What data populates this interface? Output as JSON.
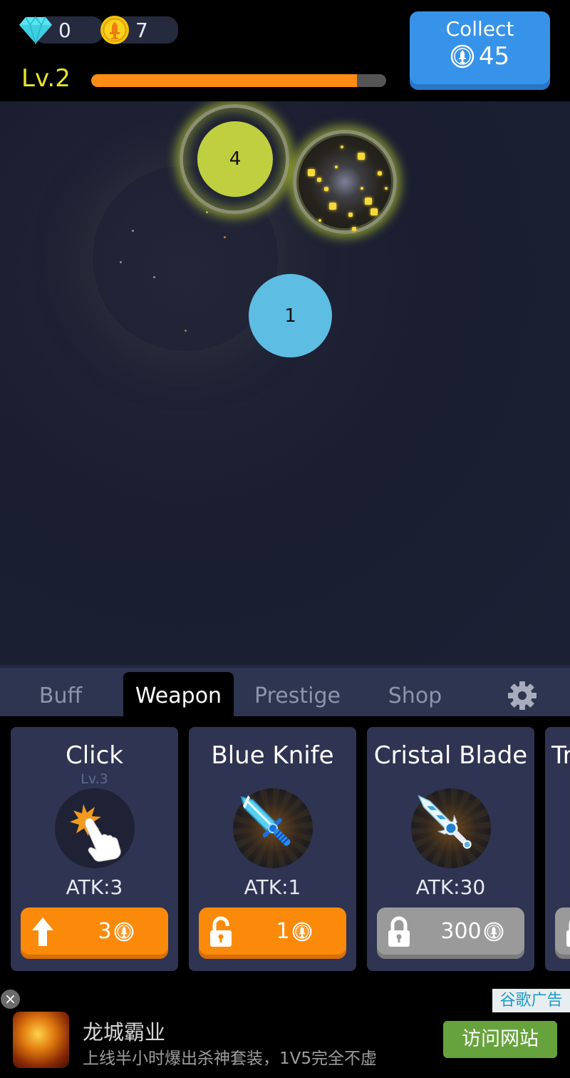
{
  "header": {
    "gems": "0",
    "coins": "7",
    "level_label": "Lv.2",
    "xp_progress_percent": 90,
    "collect": {
      "label": "Collect",
      "amount": "45"
    }
  },
  "field": {
    "targets": [
      {
        "label": "4",
        "color": "#bfcf3f"
      },
      {
        "label": "1",
        "color": "#5ebde3"
      }
    ]
  },
  "tabs": [
    {
      "label": "Buff",
      "active": false
    },
    {
      "label": "Weapon",
      "active": true
    },
    {
      "label": "Prestige",
      "active": false
    },
    {
      "label": "Shop",
      "active": false
    }
  ],
  "settings_icon": "gear-icon",
  "cards": [
    {
      "name": "Click",
      "level": "Lv.3",
      "atk": "ATK:3",
      "button": {
        "type": "upgrade",
        "icon": "arrow-up-icon",
        "price": "3",
        "state": "available"
      }
    },
    {
      "name": "Blue Knife",
      "level": "",
      "atk": "ATK:1",
      "button": {
        "type": "unlock",
        "icon": "unlocked-padlock-icon",
        "price": "1",
        "state": "available"
      }
    },
    {
      "name": "Cristal Blade",
      "level": "",
      "atk": "ATK:30",
      "button": {
        "type": "unlock",
        "icon": "locked-padlock-icon",
        "price": "300",
        "state": "locked"
      }
    },
    {
      "name": "Tr",
      "level": "",
      "atk": "",
      "button": {
        "type": "unlock",
        "icon": "locked-padlock-icon",
        "price": "",
        "state": "locked"
      }
    }
  ],
  "colors": {
    "accent_orange": "#fb8a0a",
    "collect_blue": "#3793e9",
    "level_yellow": "#e6e32e",
    "card_bg": "#2e3451",
    "locked_grey": "#9a9a9a"
  },
  "ad": {
    "close_label": "×",
    "badge": "谷歌广告",
    "title": "龙城霸业",
    "description": "上线半小时爆出杀神套装，1V5完全不虚",
    "cta": "访问网站"
  }
}
